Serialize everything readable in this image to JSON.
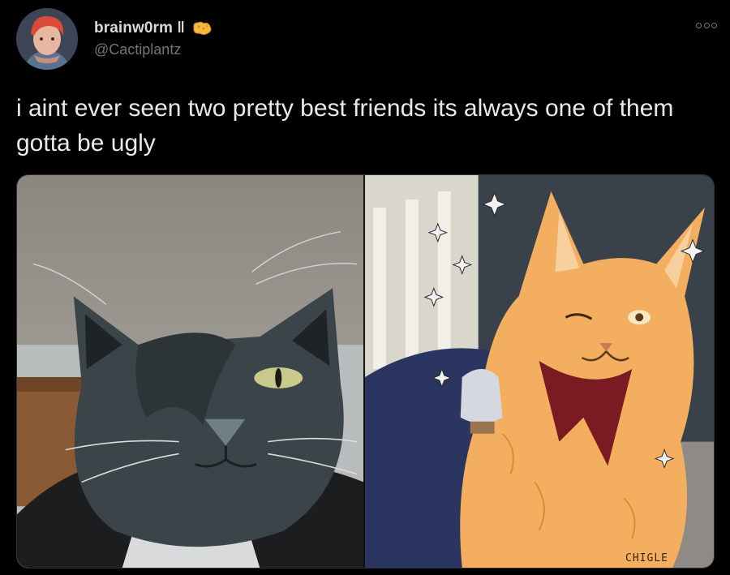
{
  "tweet": {
    "author": {
      "display_name": "brainw0rm ‖",
      "handle": "@Cactiplantz",
      "badge_icon": "sponge-emoji-icon",
      "avatar_icon": "avatar-icon"
    },
    "text": "i aint ever seen two pretty best friends its always one of them gotta be ugly",
    "more_icon": "more-options-icon",
    "media": [
      {
        "description_icon": "gray-cat-drawing-icon"
      },
      {
        "description_icon": "orange-cat-drawing-icon",
        "signature": "CHIGLE"
      }
    ]
  },
  "colors": {
    "background": "#000000",
    "name": "#d9d9d9",
    "handle": "#6e767d",
    "text": "#e7e9ea",
    "badge": "#f5b93f"
  }
}
